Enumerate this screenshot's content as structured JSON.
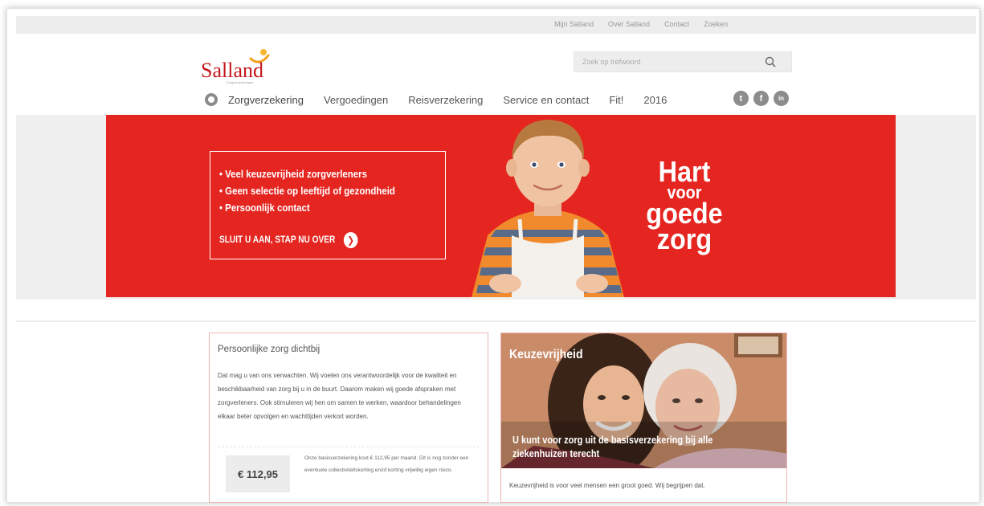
{
  "top_links": [
    "Mijn Salland",
    "Over Salland",
    "Contact",
    "Zoeken"
  ],
  "brand": {
    "name": "Salland",
    "tagline": "Zorgverzekeringen",
    "color": "#c4161c"
  },
  "search": {
    "placeholder": "Zoek op trefwoord",
    "icon": "search-icon"
  },
  "nav": {
    "home_icon": "home-icon",
    "items": [
      "Zorgverzekering",
      "Vergoedingen",
      "Reisverzekering",
      "Service en contact",
      "Fit!",
      "2016"
    ]
  },
  "social": [
    {
      "icon": "twitter-icon",
      "glyph": "t"
    },
    {
      "icon": "facebook-icon",
      "glyph": "f"
    },
    {
      "icon": "linkedin-icon",
      "glyph": "in"
    }
  ],
  "hero": {
    "bullets": [
      "• Veel keuzevrijheid zorgverleners",
      "• Geen selectie op leeftijd of gezondheid",
      "• Persoonlijk contact"
    ],
    "cta": "SLUIT U AAN, STAP NU OVER",
    "slogan": [
      "Hart",
      "voor",
      "goede",
      "zorg"
    ],
    "color": "#e52520"
  },
  "card_left": {
    "title": "Persoonlijke zorg dichtbij",
    "body": "Dat mag u van ons verwachten. Wij voelen ons verantwoordelijk voor de kwaliteit en beschikbaarheid van zorg bij u in de buurt. Daarom maken wij goede afspraken met zorgverleners. Ook stimuleren wij hen om samen te werken, waardoor behandelingen elkaar beter opvolgen en wachttijden verkort worden.",
    "price": "€ 112,95",
    "price_text": "Onze basisverzekering kost € 112,95 per maand. Dit is nog zonder een eventuele collectiviteitskorting en/of korting vrijwillig eigen risico."
  },
  "card_right": {
    "title": "Keuzevrijheid",
    "caption": "U kunt voor zorg uit de basisverzekering bij alle ziekenhuizen terecht",
    "text": "Keuzevrijheid is voor veel mensen een groot goed. Wij begrijpen dat."
  }
}
